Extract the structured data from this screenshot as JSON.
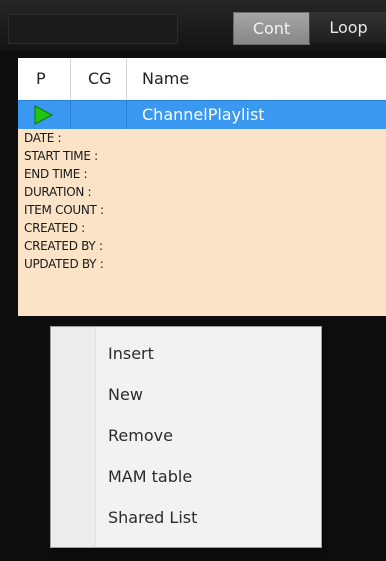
{
  "toolbar": {
    "cont_label": "Cont",
    "loop_label": "Loop"
  },
  "playlist": {
    "columns": [
      "P",
      "CG",
      "Name"
    ],
    "selected_row": {
      "name": "ChannelPlaylist",
      "status_icon": "play-icon",
      "status_color": "#22c40e"
    },
    "info_fields": [
      "DATE :",
      "START TIME :",
      "END TIME :",
      "DURATION :",
      "ITEM COUNT :",
      "CREATED :",
      "CREATED BY :",
      "UPDATED BY :"
    ]
  },
  "context_menu": {
    "items": [
      "Insert",
      "New",
      "Remove",
      "MAM table",
      "Shared List"
    ]
  },
  "colors": {
    "selection": "#3a98f0",
    "info_background": "#fbe3c8",
    "app_background": "#0d0d0d"
  }
}
